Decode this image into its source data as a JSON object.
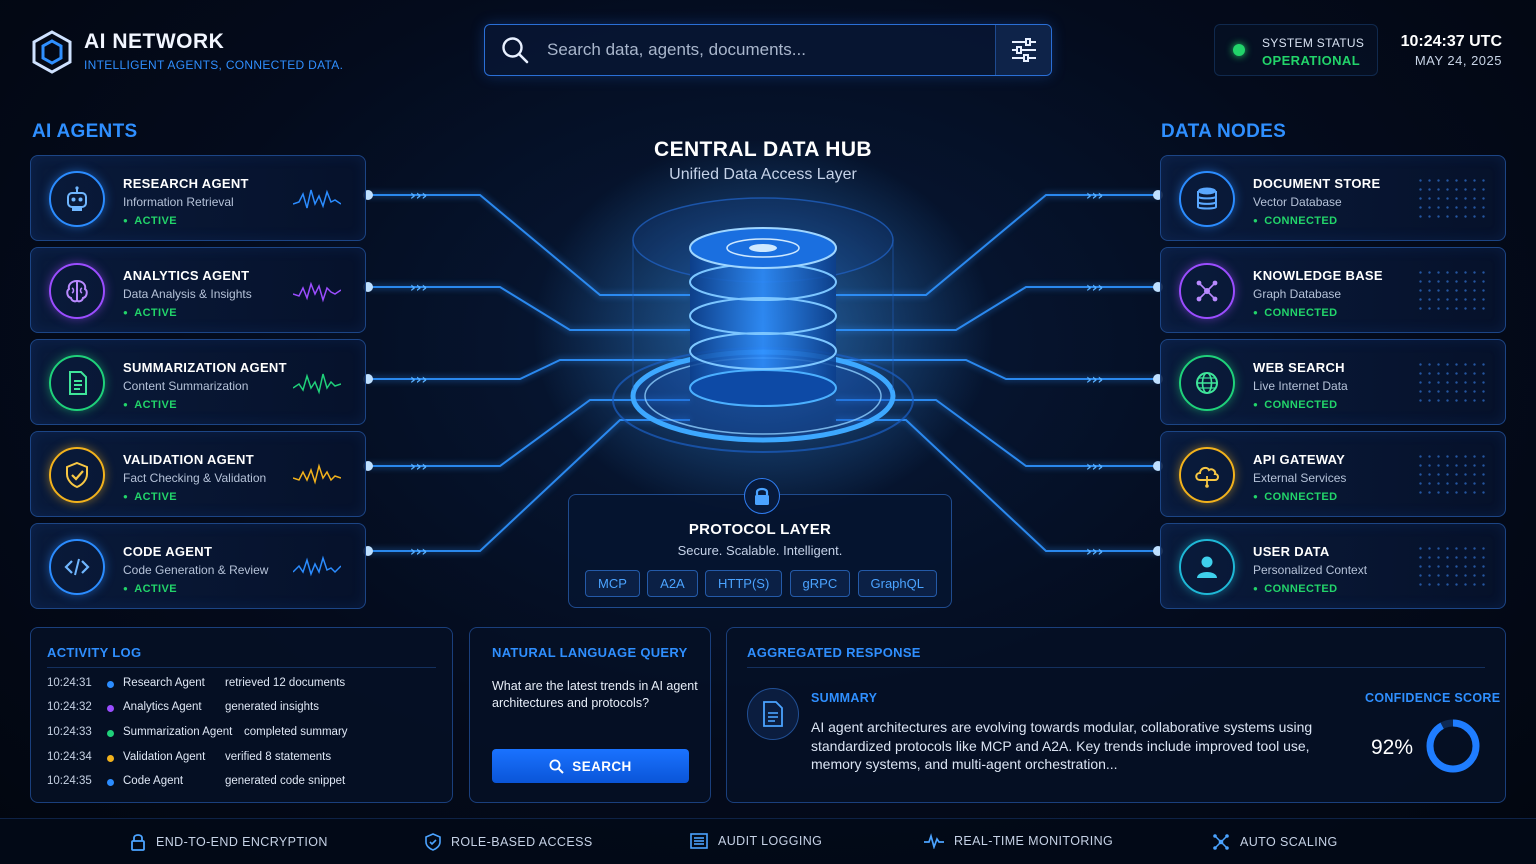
{
  "header": {
    "app_title": "AI NETWORK",
    "app_subtitle": "INTELLIGENT AGENTS, CONNECTED DATA.",
    "search_placeholder": "Search data, agents, documents...",
    "status_label": "SYSTEM STATUS",
    "status_value": "OPERATIONAL",
    "time": "10:24:37 UTC",
    "date": "MAY 24, 2025"
  },
  "agents": {
    "title": "AI AGENTS",
    "items": [
      {
        "name": "RESEARCH AGENT",
        "desc": "Information Retrieval",
        "state": "ACTIVE",
        "icon": "robot-icon",
        "color": "#2b8cff"
      },
      {
        "name": "ANALYTICS AGENT",
        "desc": "Data Analysis & Insights",
        "state": "ACTIVE",
        "icon": "brain-icon",
        "color": "#9b4dff"
      },
      {
        "name": "SUMMARIZATION AGENT",
        "desc": "Content Summarization",
        "state": "ACTIVE",
        "icon": "document-icon",
        "color": "#1fd17a"
      },
      {
        "name": "VALIDATION AGENT",
        "desc": "Fact Checking & Validation",
        "state": "ACTIVE",
        "icon": "shield-icon",
        "color": "#f2b21c"
      },
      {
        "name": "CODE AGENT",
        "desc": "Code Generation & Review",
        "state": "ACTIVE",
        "icon": "code-icon",
        "color": "#2b8cff"
      }
    ]
  },
  "hub": {
    "title": "CENTRAL DATA HUB",
    "subtitle": "Unified Data Access Layer",
    "protocol_title": "PROTOCOL LAYER",
    "protocol_subtitle": "Secure. Scalable. Intelligent.",
    "protocols": [
      "MCP",
      "A2A",
      "HTTP(S)",
      "gRPC",
      "GraphQL"
    ]
  },
  "nodes": {
    "title": "DATA NODES",
    "items": [
      {
        "name": "DOCUMENT STORE",
        "desc": "Vector Database",
        "state": "CONNECTED",
        "icon": "database-icon",
        "color": "#2b8cff"
      },
      {
        "name": "KNOWLEDGE BASE",
        "desc": "Graph Database",
        "state": "CONNECTED",
        "icon": "graph-icon",
        "color": "#9b4dff"
      },
      {
        "name": "WEB SEARCH",
        "desc": "Live Internet Data",
        "state": "CONNECTED",
        "icon": "globe-icon",
        "color": "#1fd17a"
      },
      {
        "name": "API GATEWAY",
        "desc": "External Services",
        "state": "CONNECTED",
        "icon": "cloud-icon",
        "color": "#f2b21c"
      },
      {
        "name": "USER DATA",
        "desc": "Personalized Context",
        "state": "CONNECTED",
        "icon": "user-icon",
        "color": "#1fb8d6"
      }
    ]
  },
  "activity": {
    "title": "ACTIVITY LOG",
    "rows": [
      {
        "time": "10:24:31",
        "agent": "Research Agent",
        "msg": "retrieved 12 documents",
        "color": "#2b8cff"
      },
      {
        "time": "10:24:32",
        "agent": "Analytics Agent",
        "msg": "generated insights",
        "color": "#9b4dff"
      },
      {
        "time": "10:24:33",
        "agent": "Summarization Agent",
        "msg": "completed summary",
        "color": "#1fd17a"
      },
      {
        "time": "10:24:34",
        "agent": "Validation Agent",
        "msg": "verified 8 statements",
        "color": "#f2b21c"
      },
      {
        "time": "10:24:35",
        "agent": "Code Agent",
        "msg": "generated code snippet",
        "color": "#2b8cff"
      }
    ]
  },
  "query": {
    "title": "NATURAL LANGUAGE QUERY",
    "text": "What are the latest trends in AI agent architectures and protocols?",
    "button": "SEARCH"
  },
  "response": {
    "title": "AGGREGATED RESPONSE",
    "summary_label": "SUMMARY",
    "summary": "AI agent architectures are evolving towards modular, collaborative systems using standardized protocols like MCP and A2A. Key trends include improved tool use, memory systems, and multi-agent orchestration...",
    "confidence_label": "CONFIDENCE SCORE",
    "confidence_text": "92%",
    "confidence": 0.92
  },
  "footer": {
    "items": [
      {
        "label": "END-TO-END ENCRYPTION",
        "icon": "lock-icon"
      },
      {
        "label": "ROLE-BASED ACCESS",
        "icon": "shield-check-icon"
      },
      {
        "label": "AUDIT LOGGING",
        "icon": "list-icon"
      },
      {
        "label": "REAL-TIME MONITORING",
        "icon": "pulse-icon"
      },
      {
        "label": "AUTO SCALING",
        "icon": "scaling-icon"
      }
    ]
  },
  "colors": {
    "accent": "#2f8fff",
    "ok": "#22d46a",
    "bg": "#040b1c"
  }
}
